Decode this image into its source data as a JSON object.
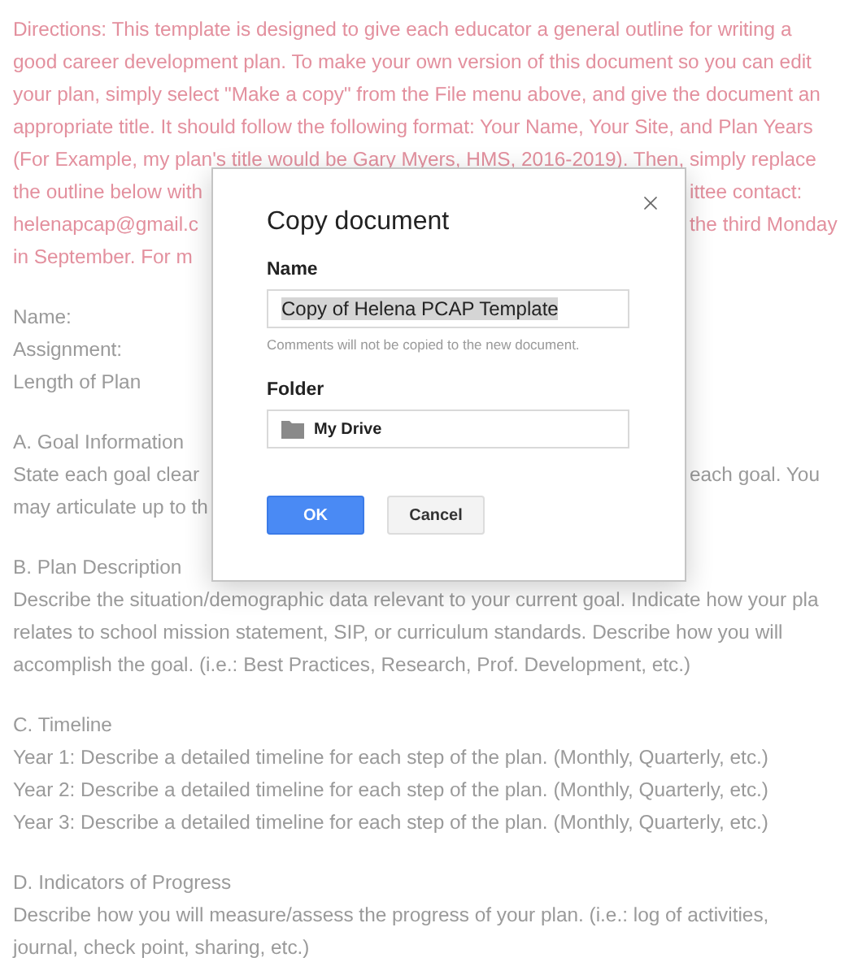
{
  "document": {
    "blocks": [
      {
        "kind": "directions",
        "lines": [
          {
            "left": "Directions:  This template is designed to give each educator a general outline for writing a"
          },
          {
            "left": "good career development plan.  To make your own version of this document so you can edit"
          },
          {
            "left": "your plan, simply select \"Make a copy\" from the File menu above, and give the document an"
          },
          {
            "left": "appropriate title.  It should follow the following format: Your Name, Your Site, and Plan Years"
          },
          {
            "left": "(For Example, my plan's title would be Gary Myers, HMS, 2016-2019).  Then, simply replace"
          },
          {
            "left": "the outline below with",
            "right": "ittee contact:"
          },
          {
            "left": "helenapcap@gmail.c",
            "right": "the third Monday"
          },
          {
            "left": "in September.  For m"
          }
        ]
      },
      {
        "kind": "body",
        "lines": [
          {
            "left": "Name:"
          },
          {
            "left": "Assignment:"
          },
          {
            "left": "Length of Plan"
          }
        ]
      },
      {
        "kind": "body",
        "lines": [
          {
            "left": "A.  Goal Information"
          },
          {
            "left": "State each goal clear",
            "right": "each goal.  You"
          },
          {
            "left": "may articulate up to th"
          }
        ]
      },
      {
        "kind": "body",
        "lines": [
          {
            "left": "B. Plan Description"
          },
          {
            "left": "Describe the situation/demographic data relevant to your current goal.  Indicate how your pla"
          },
          {
            "left": "relates to school mission statement, SIP, or curriculum standards.  Describe how you will"
          },
          {
            "left": "accomplish the goal. (i.e.: Best Practices, Research, Prof. Development, etc.)"
          }
        ]
      },
      {
        "kind": "body",
        "lines": [
          {
            "left": "C.  Timeline"
          },
          {
            "left": "Year 1: Describe a detailed timeline for each step of the plan. (Monthly, Quarterly, etc.)"
          },
          {
            "left": "Year 2: Describe a detailed timeline for each step of the plan. (Monthly, Quarterly, etc.)"
          },
          {
            "left": "Year 3: Describe a detailed timeline for each step of the plan. (Monthly, Quarterly, etc.)"
          }
        ]
      },
      {
        "kind": "body",
        "lines": [
          {
            "left": "D.  Indicators of Progress"
          },
          {
            "left": "Describe how you will measure/assess the progress of your plan. (i.e.: log of activities,"
          },
          {
            "left": "journal, check point, sharing, etc.)"
          }
        ]
      }
    ]
  },
  "dialog": {
    "title": "Copy document",
    "name_label": "Name",
    "name_value": "Copy of Helena PCAP Template",
    "name_selected": true,
    "hint": "Comments will not be copied to the new document.",
    "folder_label": "Folder",
    "folder_value": "My Drive",
    "buttons": [
      {
        "label": "OK",
        "kind": "primary"
      },
      {
        "label": "Cancel",
        "kind": "secondary"
      }
    ]
  }
}
